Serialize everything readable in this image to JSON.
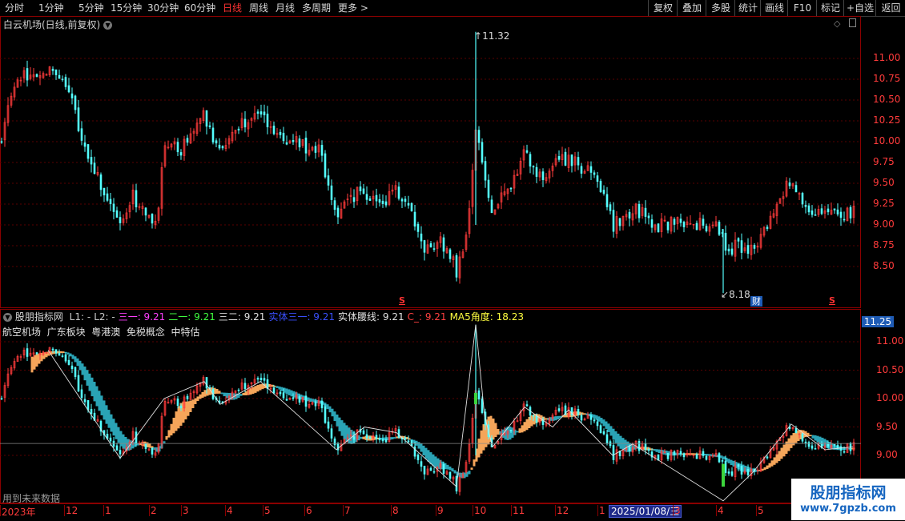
{
  "toolbar": {
    "periods": [
      {
        "label": "分时",
        "active": false
      },
      {
        "label": "1分钟",
        "active": false
      },
      {
        "label": "5分钟",
        "active": false
      },
      {
        "label": "15分钟",
        "active": false
      },
      {
        "label": "30分钟",
        "active": false
      },
      {
        "label": "60分钟",
        "active": false
      },
      {
        "label": "日线",
        "active": true
      },
      {
        "label": "周线",
        "active": false
      },
      {
        "label": "月线",
        "active": false
      },
      {
        "label": "多周期",
        "active": false
      },
      {
        "label": "更多 >",
        "active": false
      }
    ],
    "actions": [
      "复权",
      "叠加",
      "多股",
      "统计",
      "画线",
      "F10",
      "标记",
      "+自选",
      "返回"
    ]
  },
  "main_chart": {
    "title": "白云机场(日线,前复权)",
    "y_labels": [
      "11.00",
      "10.75",
      "10.50",
      "10.25",
      "10.00",
      "9.75",
      "9.50",
      "9.25",
      "9.00",
      "8.75",
      "8.50"
    ],
    "high_marker": "11.32",
    "low_marker": "8.18",
    "badges": {
      "s1": "S",
      "finance": "财",
      "s2": "S"
    }
  },
  "indicator": {
    "name": "股朋指标网",
    "legend": [
      {
        "label": "L1:",
        "value": "-",
        "color": "#c8c8c8"
      },
      {
        "label": "L2:",
        "value": "-",
        "color": "#c8c8c8"
      },
      {
        "label": "三一:",
        "value": "9.21",
        "color": "#ff40ff"
      },
      {
        "label": "二一:",
        "value": "9.21",
        "color": "#40ff40"
      },
      {
        "label": "三二:",
        "value": "9.21",
        "color": "#e0e0e0"
      },
      {
        "label": "实体三一:",
        "value": "9.21",
        "color": "#3a50ff"
      },
      {
        "label": "实体腰线:",
        "value": "9.21",
        "color": "#e0e0e0"
      },
      {
        "label": "C_:",
        "value": "9.21",
        "color": "#ff4040"
      },
      {
        "label": "MA5角度:",
        "value": "18.23",
        "color": "#ffff40"
      }
    ],
    "tags": "航空机场  广东板块  粤港澳  免税概念  中特估",
    "y_labels": [
      "11.00",
      "10.50",
      "10.00",
      "9.50",
      "9.00"
    ],
    "current_price": "11.25",
    "footer_note": "用到未来数据"
  },
  "time_axis": {
    "labels": [
      "2023年",
      "12",
      "1",
      "2",
      "3",
      "4",
      "5",
      "6",
      "7",
      "8",
      "9",
      "10",
      "11",
      "12",
      "1",
      "2025/01/08/三",
      "3",
      "4",
      "5"
    ]
  },
  "watermark": {
    "title": "股朋指标网",
    "url": "www.7gpzb.com"
  },
  "colors": {
    "up": "#ff3b3b",
    "down": "#54ffff",
    "band_up": "#f5a55a",
    "band_down": "#2aa3b5",
    "accent": "#1565c0"
  }
}
